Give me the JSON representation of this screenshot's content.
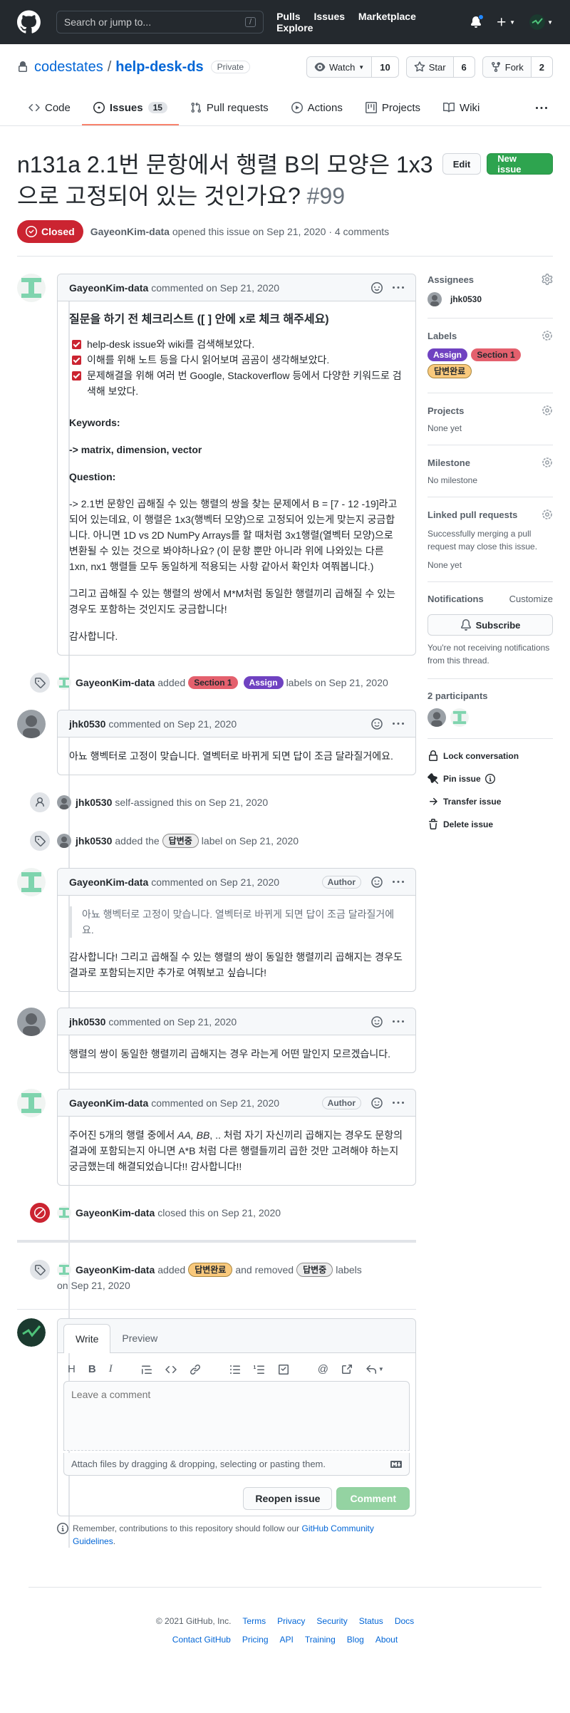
{
  "header": {
    "search_placeholder": "Search or jump to...",
    "search_key": "/",
    "nav": [
      "Pulls",
      "Issues",
      "Marketplace",
      "Explore"
    ]
  },
  "repo": {
    "owner": "codestates",
    "name": "help-desk-ds",
    "visibility": "Private",
    "watch_label": "Watch",
    "watch_count": "10",
    "star_label": "Star",
    "star_count": "6",
    "fork_label": "Fork",
    "fork_count": "2",
    "tabs": [
      {
        "label": "Code"
      },
      {
        "label": "Issues",
        "count": "15"
      },
      {
        "label": "Pull requests"
      },
      {
        "label": "Actions"
      },
      {
        "label": "Projects"
      },
      {
        "label": "Wiki"
      }
    ]
  },
  "issue": {
    "title": "n131a 2.1번 문항에서 행렬 B의 모양은 1x3으로 고정되어 있는 것인가요?",
    "number": "#99",
    "edit_label": "Edit",
    "new_issue_label": "New issue",
    "state": "Closed",
    "author": "GayeonKim-data",
    "opened_text": "opened this issue on Sep 21, 2020 · 4 comments"
  },
  "comments": {
    "c1": {
      "author": "GayeonKim-data",
      "action": "commented on Sep 21, 2020",
      "heading": "질문을 하기 전 체크리스트 ([ ] 안에 x로 체크 해주세요)",
      "tasks": [
        "help-desk issue와 wiki를 검색해보았다.",
        "이해를 위해 노트 등을 다시 읽어보며 곰곰이 생각해보았다.",
        "문제해결을 위해 여러 번 Google, Stackoverflow 등에서 다양한 키워드로 검색해 보았다."
      ],
      "keywords_label": "Keywords:",
      "keywords": "-> matrix, dimension, vector",
      "question_label": "Question:",
      "question": "-> 2.1번 문항인 곱해질 수 있는 행렬의 쌍을 찾는 문제에서 B = [7 - 12 -19]라고 되어 있는데요, 이 행렬은 1x3(행벡터 모양)으로 고정되어 있는게 맞는지 궁금합니다. 아니면 1D vs 2D NumPy Arrays를 할 때처럼 3x1행렬(열벡터 모양)으로 변환될 수 있는 것으로 봐야하나요? (이 문항 뿐만 아니라 위에 나와있는 다른 1xn, nx1 행렬들 모두 동일하게 적용되는 사항 같아서 확인차 여쭤봅니다.)",
      "p2": "그리고 곱해질 수 있는 행렬의 쌍에서 M*M처럼 동일한 행렬끼리 곱해질 수 있는 경우도 포함하는 것인지도 궁금합니다!",
      "thanks": "감사합니다."
    },
    "e1": {
      "author": "GayeonKim-data",
      "verb": "added",
      "labels": [
        "Section 1",
        "Assign"
      ],
      "suffix": "labels on Sep 21, 2020"
    },
    "c2": {
      "author": "jhk0530",
      "action": "commented on Sep 21, 2020",
      "body": "아뇨 행벡터로 고정이 맞습니다. 열벡터로 바뀌게 되면 답이 조금 달라질거에요."
    },
    "e2": {
      "author": "jhk0530",
      "text": "self-assigned this on Sep 21, 2020"
    },
    "e3": {
      "author": "jhk0530",
      "verb": "added the",
      "label": "답변중",
      "suffix": "label on Sep 21, 2020"
    },
    "c3": {
      "author": "GayeonKim-data",
      "action": "commented on Sep 21, 2020",
      "badge": "Author",
      "quote": "아뇨 행벡터로 고정이 맞습니다. 열벡터로 바뀌게 되면 답이 조금 달라질거에요.",
      "body": "감사합니다! 그리고 곱해질 수 있는 행렬의 쌍이 동일한 행렬끼리 곱해지는 경우도 결과로 포함되는지만 추가로 여쭤보고 싶습니다!"
    },
    "c4": {
      "author": "jhk0530",
      "action": "commented on Sep 21, 2020",
      "body": "행렬의 쌍이 동일한 행렬끼리 곱해지는 경우 라는게 어떤 말인지 모르겠습니다."
    },
    "c5": {
      "author": "GayeonKim-data",
      "action": "commented on Sep 21, 2020",
      "badge": "Author",
      "body_a": "주어진 5개의 행렬 중에서 ",
      "body_em": "AA, BB",
      "body_b": ", .. 처럼 자기 자신끼리 곱해지는 경우도 문항의 결과에 포함되는지 아니면 A*B 처럼 다른 행렬들끼리 곱한 것만 고려해야 하는지 궁금했는데 해결되었습니다!! 감사합니다!!"
    },
    "e4": {
      "author": "GayeonKim-data",
      "text": "closed this on Sep 21, 2020"
    },
    "e5": {
      "author": "GayeonKim-data",
      "verb": "added",
      "added_label": "답변완료",
      "mid": "and removed",
      "removed_label": "답변중",
      "suffix": "labels",
      "date": "on Sep 21, 2020"
    }
  },
  "sidebar": {
    "assignees_title": "Assignees",
    "assignee": "jhk0530",
    "labels_title": "Labels",
    "labels": [
      "Assign",
      "Section 1",
      "답변완료"
    ],
    "projects_title": "Projects",
    "projects_value": "None yet",
    "milestone_title": "Milestone",
    "milestone_value": "No milestone",
    "linked_title": "Linked pull requests",
    "linked_desc": "Successfully merging a pull request may close this issue.",
    "linked_value": "None yet",
    "notifications_title": "Notifications",
    "customize": "Customize",
    "subscribe": "Subscribe",
    "notif_desc": "You're not receiving notifications from this thread.",
    "participants": "2 participants",
    "actions": [
      "Lock conversation",
      "Pin issue",
      "Transfer issue",
      "Delete issue"
    ]
  },
  "editor": {
    "tab_write": "Write",
    "tab_preview": "Preview",
    "placeholder": "Leave a comment",
    "attach": "Attach files by dragging & dropping, selecting or pasting them.",
    "reopen": "Reopen issue",
    "comment": "Comment",
    "remember_a": "Remember, contributions to this repository should follow our ",
    "remember_link": "GitHub Community Guidelines",
    "remember_b": "."
  },
  "footer": {
    "copyright": "© 2021 GitHub, Inc.",
    "row1": [
      "Terms",
      "Privacy",
      "Security",
      "Status",
      "Docs"
    ],
    "row2": [
      "Contact GitHub",
      "Pricing",
      "API",
      "Training",
      "Blog",
      "About"
    ]
  },
  "colors": {
    "assign": "#6f42c1",
    "section1": "#e4606d",
    "answered": "#f9c97c",
    "answering": "#ededed",
    "closed": "#cb2431",
    "green": "#2ea44f"
  }
}
